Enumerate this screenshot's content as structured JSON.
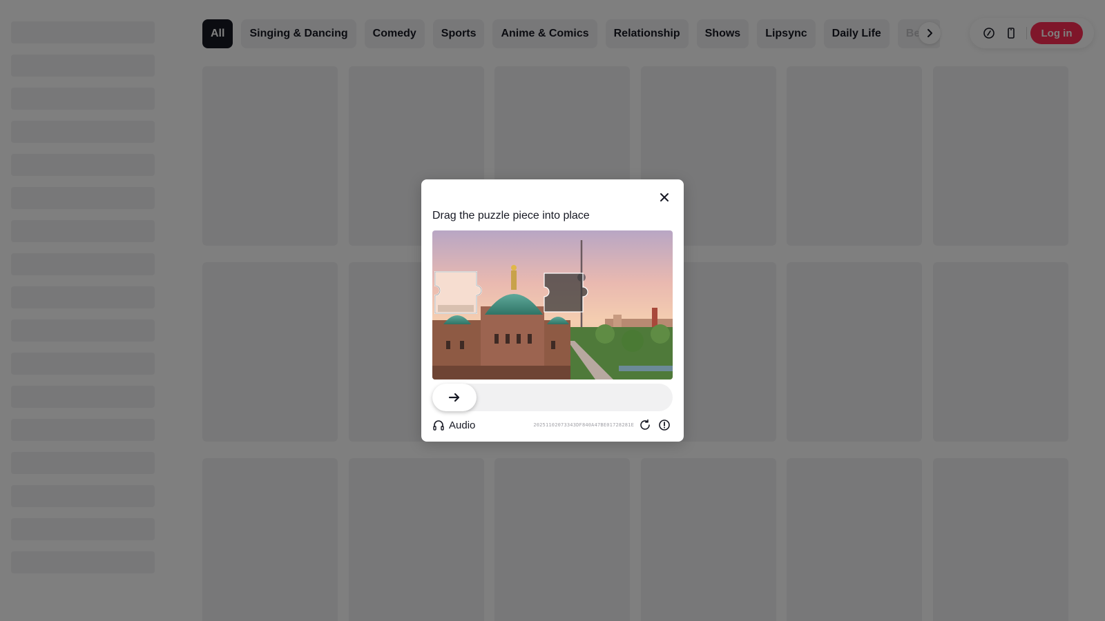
{
  "categories": [
    {
      "label": "All",
      "active": true
    },
    {
      "label": "Singing & Dancing"
    },
    {
      "label": "Comedy"
    },
    {
      "label": "Sports"
    },
    {
      "label": "Anime & Comics"
    },
    {
      "label": "Relationship"
    },
    {
      "label": "Shows"
    },
    {
      "label": "Lipsync"
    },
    {
      "label": "Daily Life"
    },
    {
      "label": "Beau"
    }
  ],
  "header": {
    "login_label": "Log in",
    "icons": [
      "coin-icon",
      "phone-icon"
    ],
    "accent_color": "#fe2c55"
  },
  "captcha": {
    "title": "Drag the puzzle piece into place",
    "audio_label": "Audio",
    "captcha_id": "20251102073343DF840A47BE01728281E",
    "slider_icon": "arrow-right-icon"
  }
}
